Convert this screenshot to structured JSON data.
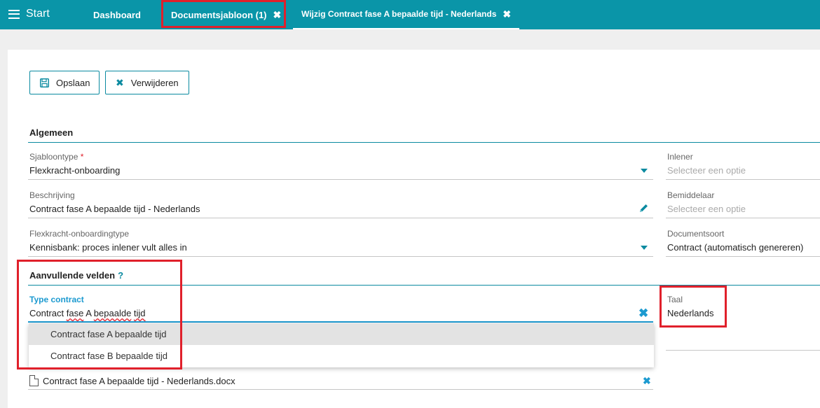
{
  "topbar": {
    "menu_label": "Start",
    "tabs": [
      {
        "label": "Dashboard"
      },
      {
        "label": "Documentsjabloon (1)",
        "close": "✖"
      },
      {
        "label": "Wijzig Contract fase A bepaalde tijd - Nederlands",
        "close": "✖"
      }
    ]
  },
  "toolbar": {
    "save_label": "Opslaan",
    "delete_label": "Verwijderen"
  },
  "general": {
    "title": "Algemeen",
    "template_type": {
      "label": "Sjabloontype",
      "required": "*",
      "value": "Flexkracht-onboarding"
    },
    "description": {
      "label": "Beschrijving",
      "value": "Contract fase A bepaalde tijd - Nederlands"
    },
    "onboarding_type": {
      "label": "Flexkracht-onboardingtype",
      "value": "Kennisbank: proces inlener vult alles in"
    },
    "hirer": {
      "label": "Inlener",
      "placeholder": "Selecteer een optie"
    },
    "intermediary": {
      "label": "Bemiddelaar",
      "placeholder": "Selecteer een optie"
    },
    "document_type": {
      "label": "Documentsoort",
      "value": "Contract (automatisch genereren)"
    }
  },
  "additional": {
    "title": "Aanvullende velden",
    "help": "?",
    "contract_type": {
      "label": "Type contract",
      "value_prefix": "Contract ",
      "value_wavy1": "fase",
      "value_mid": " A ",
      "value_wavy2": "bepaalde",
      "value_space": " ",
      "value_wavy3": "tijd"
    },
    "language": {
      "label": "Taal",
      "value": "Nederlands"
    },
    "options": [
      "Contract fase A bepaalde tijd",
      "Contract fase B bepaalde tijd"
    ],
    "file": "Contract fase A bepaalde tijd - Nederlands.docx"
  },
  "colors": {
    "accent": "#0a95a8",
    "highlight": "#e0202b",
    "focus": "#1c9ad0"
  }
}
